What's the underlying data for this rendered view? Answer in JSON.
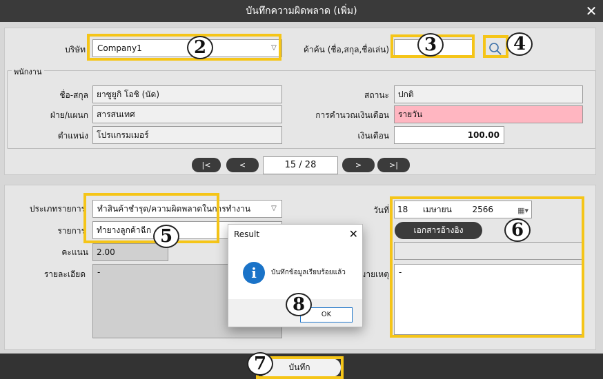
{
  "window": {
    "title": "บันทึกความผิดพลาด (เพิ่ม)",
    "close_glyph": "✕"
  },
  "top": {
    "company_label": "บริษัท",
    "company_value": "Company1",
    "search_label": "ค้าค้น (ชื่อ,สกุล,ชื่อเล่น)",
    "search_value": "",
    "employee_group": "พนักงาน",
    "name_label": "ชื่อ-สกุล",
    "name_value": "ยาซูยูกิ  โอชิ (นัด)",
    "dept_label": "ฝ่าย/แผนก",
    "dept_value": "สารสนเทศ",
    "position_label": "ตำแหน่ง",
    "position_value": "โปรแกรมเมอร์",
    "status_label": "สถานะ",
    "status_value": "ปกติ",
    "salary_calc_label": "การคำนวณเงินเดือน",
    "salary_calc_value": "รายวัน",
    "salary_label": "เงินเดือน",
    "salary_value": "100.00"
  },
  "nav": {
    "first": "|<",
    "prev": "<",
    "page": "15 / 28",
    "next": ">",
    "last": ">|"
  },
  "bottom": {
    "type_label": "ประเภทรายการ",
    "type_value": "ทำสินค้าชำรุด/ความผิดพลาดในการทำงาน",
    "item_label": "รายการ",
    "item_value": "ทำยางลูกค้าฉีก",
    "score_label": "คะแนน",
    "score_value": "2.00",
    "detail_label": "รายละเอียด",
    "detail_value": "-",
    "date_label": "วันที่",
    "date_day": "18",
    "date_month": "เมษายน",
    "date_year": "2566",
    "ref_doc_button": "เอกสารอ้างอิง",
    "ref_doc_value": "",
    "remark_label": "หมายเหตุ",
    "remark_value": "-"
  },
  "footer": {
    "save_label": "บันทึก"
  },
  "dialog": {
    "title": "Result",
    "message": "บันทึกข้อมูลเรียบร้อยแล้ว",
    "ok_label": "OK",
    "close_glyph": "✕",
    "info_glyph": "i"
  },
  "annotations": [
    "2",
    "3",
    "4",
    "5",
    "6",
    "7",
    "8"
  ],
  "colors": {
    "highlight": "#f5c518",
    "dark": "#3b3b3b",
    "pink": "#ffb6c1",
    "info_blue": "#1a73c8"
  },
  "icons": {
    "search": "search-icon",
    "calendar": "calendar-icon",
    "dropdown": "chevron-down-icon"
  }
}
